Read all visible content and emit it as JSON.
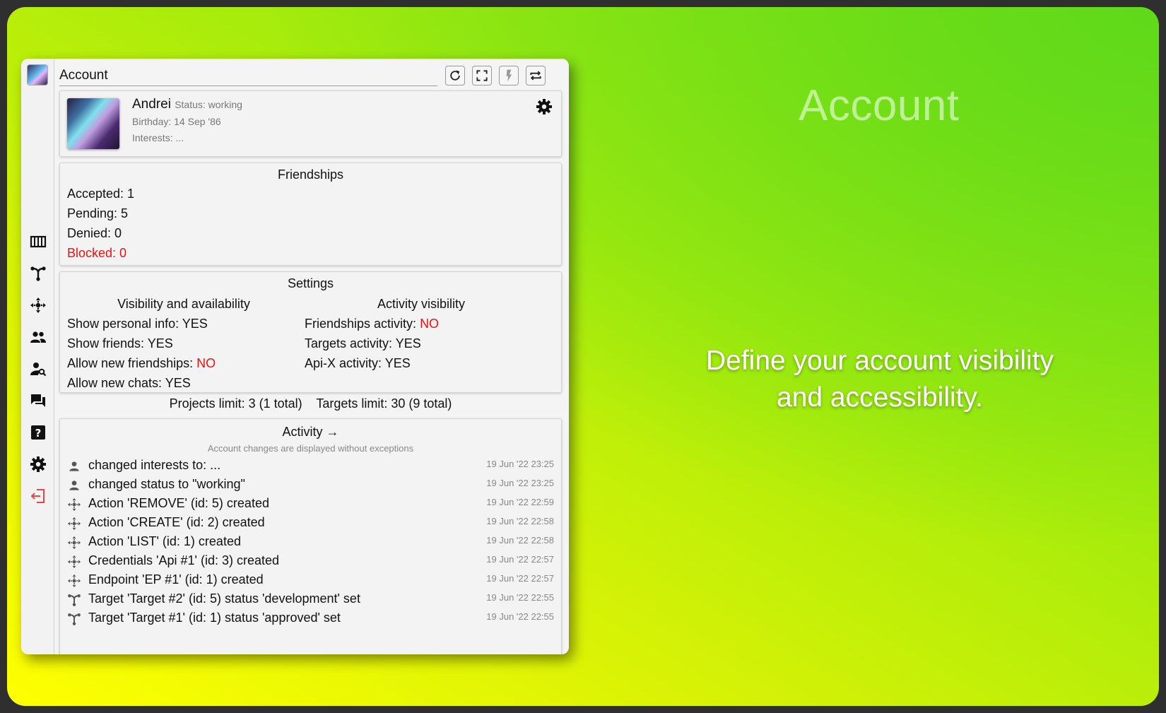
{
  "hero": {
    "title": "Account",
    "text": "Define your account visibility and accessibility."
  },
  "window": {
    "title": "Account",
    "toolbar": [
      "refresh-icon",
      "fullscreen-icon",
      "bolt-icon",
      "swap-icon"
    ]
  },
  "sidebar": {
    "items": [
      "projects-icon",
      "targets-icon",
      "api-icon",
      "friends-icon",
      "find-user-icon",
      "chats-icon",
      "help-icon",
      "settings-icon",
      "logout-icon"
    ]
  },
  "profile": {
    "name": "Andrei",
    "status": "Status: working",
    "birthday": "Birthday: 14 Sep '86",
    "interests": "Interests: ..."
  },
  "friendships": {
    "title": "Friendships",
    "accepted": "Accepted: 1",
    "pending": "Pending: 5",
    "denied": "Denied: 0",
    "blocked": "Blocked: 0"
  },
  "settings": {
    "title": "Settings",
    "left_title": "Visibility and availability",
    "right_title": "Activity visibility",
    "personal_info_label": "Show personal info: ",
    "personal_info_value": "YES",
    "show_friends_label": "Show friends: ",
    "show_friends_value": "YES",
    "new_friendships_label": "Allow new friendships: ",
    "new_friendships_value": "NO",
    "new_chats_label": "Allow new chats: ",
    "new_chats_value": "YES",
    "friendships_activity_label": "Friendships activity: ",
    "friendships_activity_value": "NO",
    "targets_activity_label": "Targets activity: ",
    "targets_activity_value": "YES",
    "apix_activity_label": "Api-X activity: ",
    "apix_activity_value": "YES"
  },
  "limits": {
    "projects": "Projects limit: 3 (1 total)",
    "targets": "Targets limit: 30 (9 total)"
  },
  "activity": {
    "title": "Activity →",
    "subtitle": "Account changes are displayed without exceptions",
    "items": [
      {
        "icon": "user-icon",
        "text": "changed interests to: ...",
        "time": "19 Jun '22 23:25"
      },
      {
        "icon": "user-icon",
        "text": "changed status to \"working\"",
        "time": "19 Jun '22 23:25"
      },
      {
        "icon": "api-icon",
        "text": "Action 'REMOVE' (id: 5) created",
        "time": "19 Jun '22 22:59"
      },
      {
        "icon": "api-icon",
        "text": "Action 'CREATE' (id: 2) created",
        "time": "19 Jun '22 22:58"
      },
      {
        "icon": "api-icon",
        "text": "Action 'LIST' (id: 1) created",
        "time": "19 Jun '22 22:58"
      },
      {
        "icon": "api-icon",
        "text": "Credentials 'Api #1' (id: 3) created",
        "time": "19 Jun '22 22:57"
      },
      {
        "icon": "api-icon",
        "text": "Endpoint 'EP #1' (id: 1) created",
        "time": "19 Jun '22 22:57"
      },
      {
        "icon": "target-icon",
        "text": "Target 'Target #2' (id: 5) status 'development' set",
        "time": "19 Jun '22 22:55"
      },
      {
        "icon": "target-icon",
        "text": "Target 'Target #1' (id: 1) status 'approved' set",
        "time": "19 Jun '22 22:55"
      }
    ]
  },
  "colors": {
    "negative": "#ee1111",
    "logout": "#e24a4a"
  }
}
